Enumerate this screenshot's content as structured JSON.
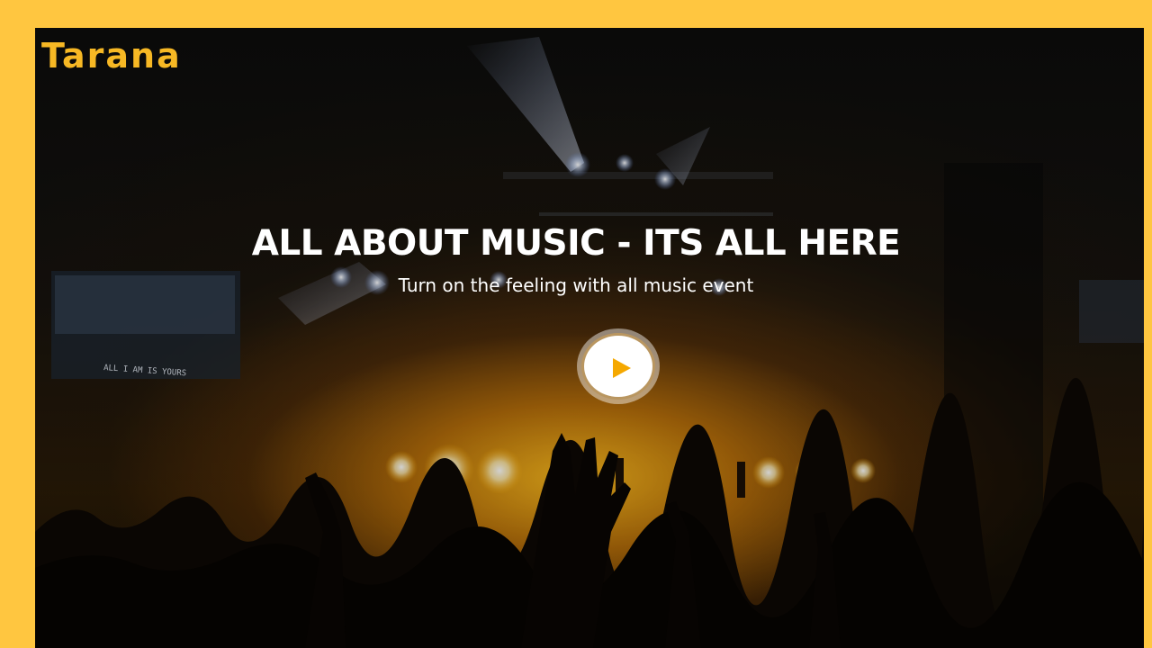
{
  "brand": {
    "name": "Tarana"
  },
  "hero": {
    "headline": "ALL ABOUT MUSIC - ITS ALL HERE",
    "subline": "Turn on the feeling with all music event",
    "background_caption": "ALL I AM IS YOURS",
    "play_icon": "play-icon"
  },
  "colors": {
    "accent": "#FFC640",
    "brand_text": "#F7B824",
    "play_triangle": "#F5A800",
    "text": "#FFFFFF"
  }
}
